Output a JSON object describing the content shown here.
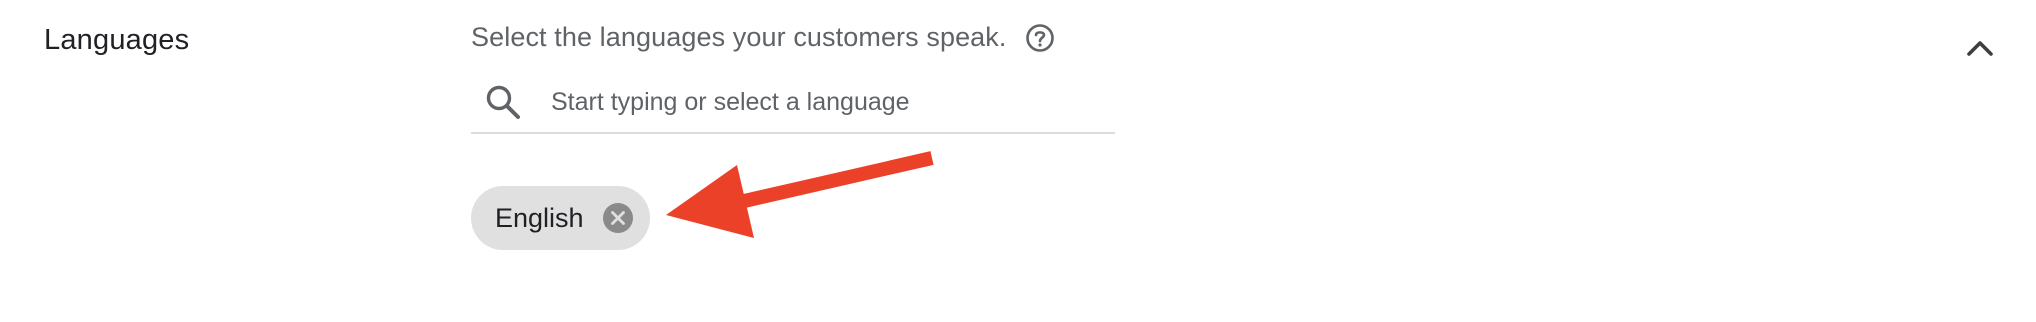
{
  "section": {
    "label": "Languages"
  },
  "helper": {
    "text": "Select the languages your customers speak."
  },
  "search": {
    "placeholder": "Start typing or select a language",
    "value": ""
  },
  "selected_languages": [
    {
      "label": "English"
    }
  ],
  "icons": {
    "help": "help-circle-icon",
    "search": "search-icon",
    "remove": "close-circle-icon",
    "collapse": "chevron-up-icon"
  },
  "colors": {
    "chip_background": "#e0e0e0",
    "annotation_arrow": "#ea4128",
    "helper_text": "#5f6368"
  }
}
